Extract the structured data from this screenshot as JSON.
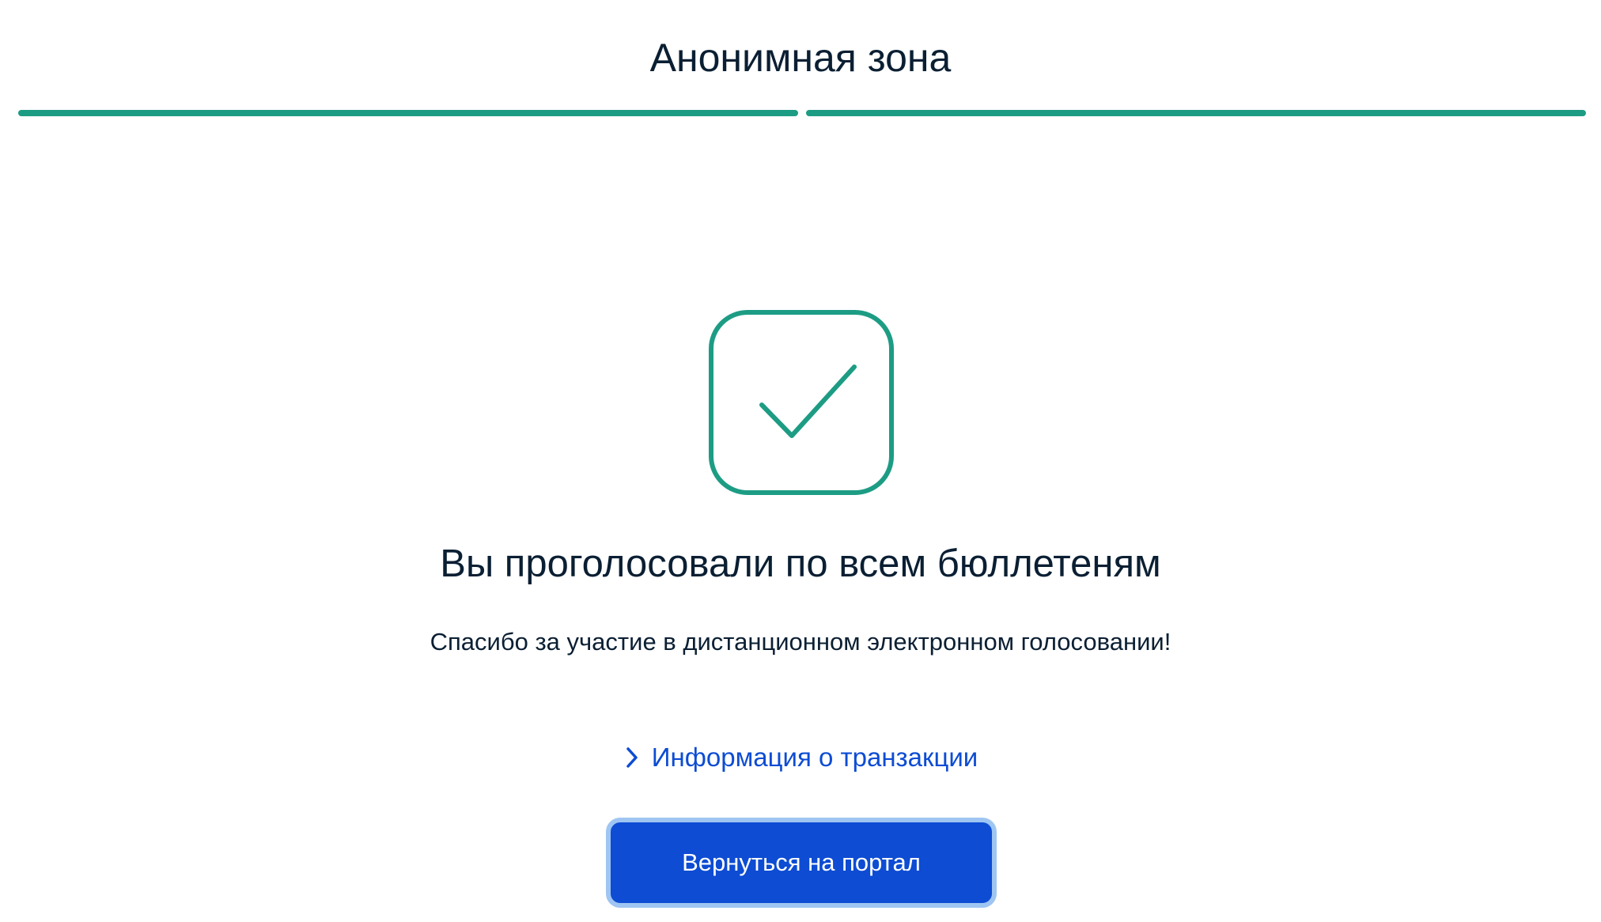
{
  "header": {
    "title": "Анонимная зона"
  },
  "progress": {
    "total_steps": 2,
    "completed_steps": 2,
    "color": "#1d9c84"
  },
  "result": {
    "icon": "checkmark-icon",
    "icon_color": "#1d9c84",
    "title": "Вы проголосовали по всем бюллетеням",
    "subtitle": "Спасибо за участие в дистанционном электронном голосовании!"
  },
  "transaction_link": {
    "icon": "chevron-right-icon",
    "label": "Информация о транзакции",
    "color": "#0d4cd3"
  },
  "actions": {
    "return_label": "Вернуться на портал",
    "button_color": "#0d4cd3"
  }
}
